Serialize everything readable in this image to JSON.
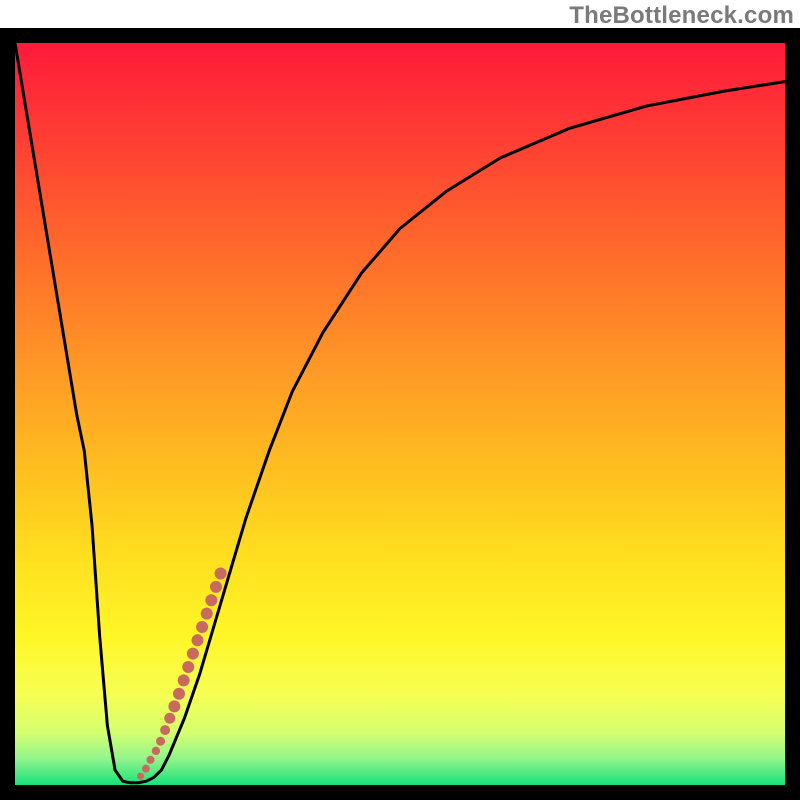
{
  "watermark": "TheBottleneck.com",
  "colors": {
    "border": "#000000",
    "curve": "#000000",
    "marker": "#c96a60",
    "gradient_stops": [
      {
        "offset": 0.0,
        "color": "#ff1a3a"
      },
      {
        "offset": 0.12,
        "color": "#ff3b34"
      },
      {
        "offset": 0.28,
        "color": "#ff6a2b"
      },
      {
        "offset": 0.44,
        "color": "#ff9926"
      },
      {
        "offset": 0.58,
        "color": "#ffc020"
      },
      {
        "offset": 0.7,
        "color": "#ffe120"
      },
      {
        "offset": 0.8,
        "color": "#fff627"
      },
      {
        "offset": 0.88,
        "color": "#f6ff54"
      },
      {
        "offset": 0.93,
        "color": "#d4ff70"
      },
      {
        "offset": 0.965,
        "color": "#90f58c"
      },
      {
        "offset": 1.0,
        "color": "#18e27a"
      }
    ]
  },
  "chart_data": {
    "type": "line",
    "title": "",
    "xlabel": "",
    "ylabel": "",
    "xlim": [
      0,
      100
    ],
    "ylim": [
      0,
      100
    ],
    "series": [
      {
        "name": "curve",
        "x": [
          0,
          4,
          8,
          9,
          10,
          11,
          12,
          13,
          14,
          15,
          16,
          17,
          18,
          19,
          20,
          22,
          24,
          26,
          28,
          30,
          33,
          36,
          40,
          45,
          50,
          56,
          63,
          72,
          82,
          92,
          100
        ],
        "values": [
          100,
          75,
          50,
          45,
          35,
          20,
          8,
          2,
          0.5,
          0.3,
          0.3,
          0.5,
          1,
          2,
          4,
          9,
          15,
          22,
          29,
          36,
          45,
          53,
          61,
          69,
          75,
          80,
          84.5,
          88.5,
          91.5,
          93.5,
          94.8
        ]
      }
    ],
    "markers": {
      "name": "highlighted",
      "points": [
        {
          "x": 16.3,
          "y": 1.2,
          "r": 3.5
        },
        {
          "x": 17.0,
          "y": 2.2,
          "r": 4.0
        },
        {
          "x": 17.6,
          "y": 3.4,
          "r": 4.0
        },
        {
          "x": 18.3,
          "y": 4.6,
          "r": 4.2
        },
        {
          "x": 18.9,
          "y": 5.9,
          "r": 4.5
        },
        {
          "x": 19.5,
          "y": 7.4,
          "r": 5.0
        },
        {
          "x": 20.1,
          "y": 9.0,
          "r": 5.5
        },
        {
          "x": 20.7,
          "y": 10.6,
          "r": 6.0
        },
        {
          "x": 21.3,
          "y": 12.3,
          "r": 6.0
        },
        {
          "x": 21.9,
          "y": 14.1,
          "r": 6.0
        },
        {
          "x": 22.5,
          "y": 15.9,
          "r": 6.0
        },
        {
          "x": 23.1,
          "y": 17.7,
          "r": 6.0
        },
        {
          "x": 23.7,
          "y": 19.5,
          "r": 6.0
        },
        {
          "x": 24.3,
          "y": 21.3,
          "r": 6.0
        },
        {
          "x": 24.9,
          "y": 23.1,
          "r": 6.0
        },
        {
          "x": 25.5,
          "y": 24.9,
          "r": 6.0
        },
        {
          "x": 26.1,
          "y": 26.7,
          "r": 6.0
        },
        {
          "x": 26.7,
          "y": 28.5,
          "r": 6.0
        }
      ]
    }
  }
}
